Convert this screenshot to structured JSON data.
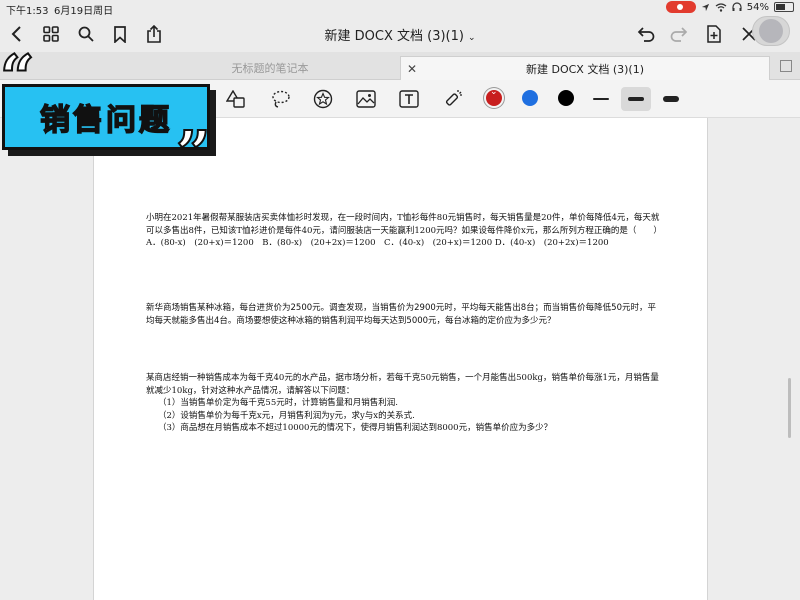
{
  "status_bar": {
    "time": "下午1:53",
    "date": "6月19日周日",
    "battery_text": "54%",
    "battery_level": 0.54
  },
  "toolbar": {
    "doc_title": "新建 DOCX 文档 (3)(1)",
    "caret": "⌄"
  },
  "tabs": [
    {
      "label": "无标题的笔记本",
      "active": false
    },
    {
      "label": "新建 DOCX 文档 (3)(1)",
      "active": true
    }
  ],
  "pen_colors": [
    "#c81e1e",
    "#1f6fe0",
    "#000000"
  ],
  "overlay": {
    "title": "销售问题",
    "open_quote": "“",
    "close_quote": "”"
  },
  "document": {
    "problem1": {
      "text": "小明在2021年暑假帮某服装店买卖体恤衫时发现，在一段时间内，T恤衫每件80元销售时，每天销售量是20件，单价每降低4元，每天就可以多售出8件，已知该T恤衫进价是每件40元，请问服装店一天能赢利1200元吗？如果设每件降价x元，那么所列方程正确的是（　　）",
      "options": "A．(80-x)　(20+x)＝1200　B．(80-x)　(20+2x)＝1200　C．(40-x)　(20+x)＝1200 D．(40-x)　(20+2x)＝1200"
    },
    "problem2": {
      "text": "新华商场销售某种冰箱，每台进货价为2500元。调查发现，当销售价为2900元时，平均每天能售出8台；而当销售价每降低50元时，平均每天就能多售出4台。商场要想使这种冰箱的销售利润平均每天达到5000元，每台冰箱的定价应为多少元？"
    },
    "problem3": {
      "text": "某商店经销一种销售成本为每千克40元的水产品，据市场分析，若每千克50元销售，一个月能售出500kg，销售单价每涨1元，月销售量就减少10kg，针对这种水产品情况，请解答以下问题：",
      "items": [
        "（1）当销售单价定为每千克55元时，计算销售量和月销售利润.",
        "（2）设销售单价为每千克x元，月销售利润为y元，求y与x的关系式.",
        "（3）商品想在月销售成本不超过10000元的情况下，使得月销售利润达到8000元，销售单价应为多少？"
      ]
    }
  }
}
